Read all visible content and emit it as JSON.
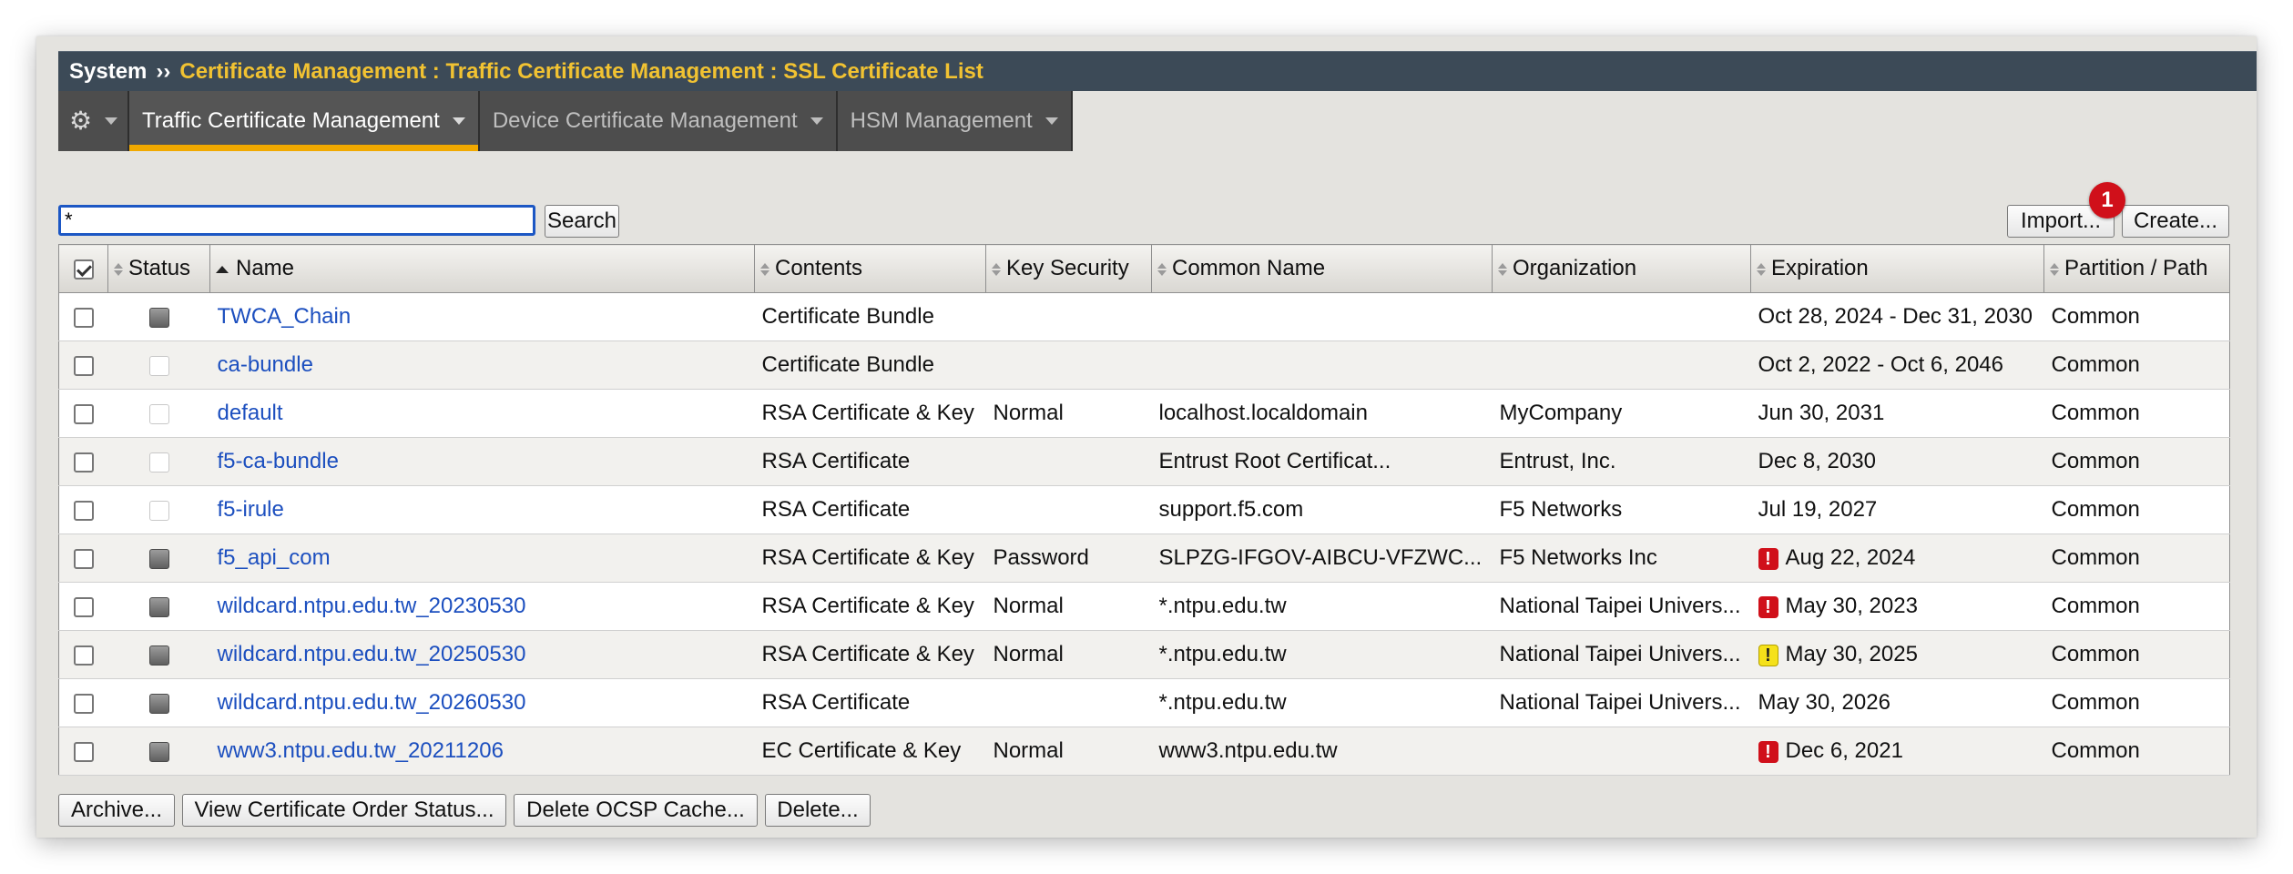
{
  "breadcrumb": {
    "root": "System",
    "separator": "››",
    "path": "Certificate Management : Traffic Certificate Management : SSL Certificate List"
  },
  "tabs": [
    {
      "label": "Traffic Certificate Management",
      "active": true
    },
    {
      "label": "Device Certificate Management",
      "active": false
    },
    {
      "label": "HSM Management",
      "active": false
    }
  ],
  "search": {
    "value": "*",
    "button": "Search"
  },
  "actions": {
    "import": "Import...",
    "create": "Create...",
    "badge": "1"
  },
  "table": {
    "columns": {
      "status": "Status",
      "name": "Name",
      "contents": "Contents",
      "key_security": "Key Security",
      "common_name": "Common Name",
      "organization": "Organization",
      "expiration": "Expiration",
      "partition": "Partition / Path"
    },
    "rows": [
      {
        "status": "grey",
        "name": "TWCA_Chain",
        "contents": "Certificate Bundle",
        "key_security": "",
        "common_name": "",
        "organization": "",
        "expiration": "Oct 28, 2024 - Dec 31, 2030",
        "exp_flag": "",
        "partition": "Common"
      },
      {
        "status": "empty",
        "name": "ca-bundle",
        "contents": "Certificate Bundle",
        "key_security": "",
        "common_name": "",
        "organization": "",
        "expiration": "Oct 2, 2022 - Oct 6, 2046",
        "exp_flag": "",
        "partition": "Common"
      },
      {
        "status": "empty",
        "name": "default",
        "contents": "RSA Certificate & Key",
        "key_security": "Normal",
        "common_name": "localhost.localdomain",
        "organization": "MyCompany",
        "expiration": "Jun 30, 2031",
        "exp_flag": "",
        "partition": "Common"
      },
      {
        "status": "empty",
        "name": "f5-ca-bundle",
        "contents": "RSA Certificate",
        "key_security": "",
        "common_name": "Entrust Root Certificat...",
        "organization": "Entrust, Inc.",
        "expiration": "Dec 8, 2030",
        "exp_flag": "",
        "partition": "Common"
      },
      {
        "status": "empty",
        "name": "f5-irule",
        "contents": "RSA Certificate",
        "key_security": "",
        "common_name": "support.f5.com",
        "organization": "F5 Networks",
        "expiration": "Jul 19, 2027",
        "exp_flag": "",
        "partition": "Common"
      },
      {
        "status": "grey",
        "name": "f5_api_com",
        "contents": "RSA Certificate & Key",
        "key_security": "Password",
        "common_name": "SLPZG-IFGOV-AIBCU-VFZWC...",
        "organization": "F5 Networks Inc",
        "expiration": "Aug 22, 2024",
        "exp_flag": "red",
        "partition": "Common"
      },
      {
        "status": "grey",
        "name": "wildcard.ntpu.edu.tw_20230530",
        "contents": "RSA Certificate & Key",
        "key_security": "Normal",
        "common_name": "*.ntpu.edu.tw",
        "organization": "National Taipei Univers...",
        "expiration": "May 30, 2023",
        "exp_flag": "red",
        "partition": "Common"
      },
      {
        "status": "grey",
        "name": "wildcard.ntpu.edu.tw_20250530",
        "contents": "RSA Certificate & Key",
        "key_security": "Normal",
        "common_name": "*.ntpu.edu.tw",
        "organization": "National Taipei Univers...",
        "expiration": "May 30, 2025",
        "exp_flag": "yellow",
        "partition": "Common"
      },
      {
        "status": "grey",
        "name": "wildcard.ntpu.edu.tw_20260530",
        "contents": "RSA Certificate",
        "key_security": "",
        "common_name": "*.ntpu.edu.tw",
        "organization": "National Taipei Univers...",
        "expiration": "May 30, 2026",
        "exp_flag": "",
        "partition": "Common"
      },
      {
        "status": "grey",
        "name": "www3.ntpu.edu.tw_20211206",
        "contents": "EC Certificate & Key",
        "key_security": "Normal",
        "common_name": "www3.ntpu.edu.tw",
        "organization": "",
        "expiration": "Dec 6, 2021",
        "exp_flag": "red",
        "partition": "Common"
      }
    ]
  },
  "footer_buttons": {
    "archive": "Archive...",
    "order_status": "View Certificate Order Status...",
    "delete_ocsp": "Delete OCSP Cache...",
    "delete": "Delete..."
  },
  "colors": {
    "accent": "#f1a900",
    "title_path": "#f1c232",
    "link": "#1c4fbf",
    "alert_red": "#d0101a",
    "alert_yellow": "#f5e11a"
  },
  "icons": {
    "settings": "gear-icon",
    "warning": "exclamation-icon"
  }
}
